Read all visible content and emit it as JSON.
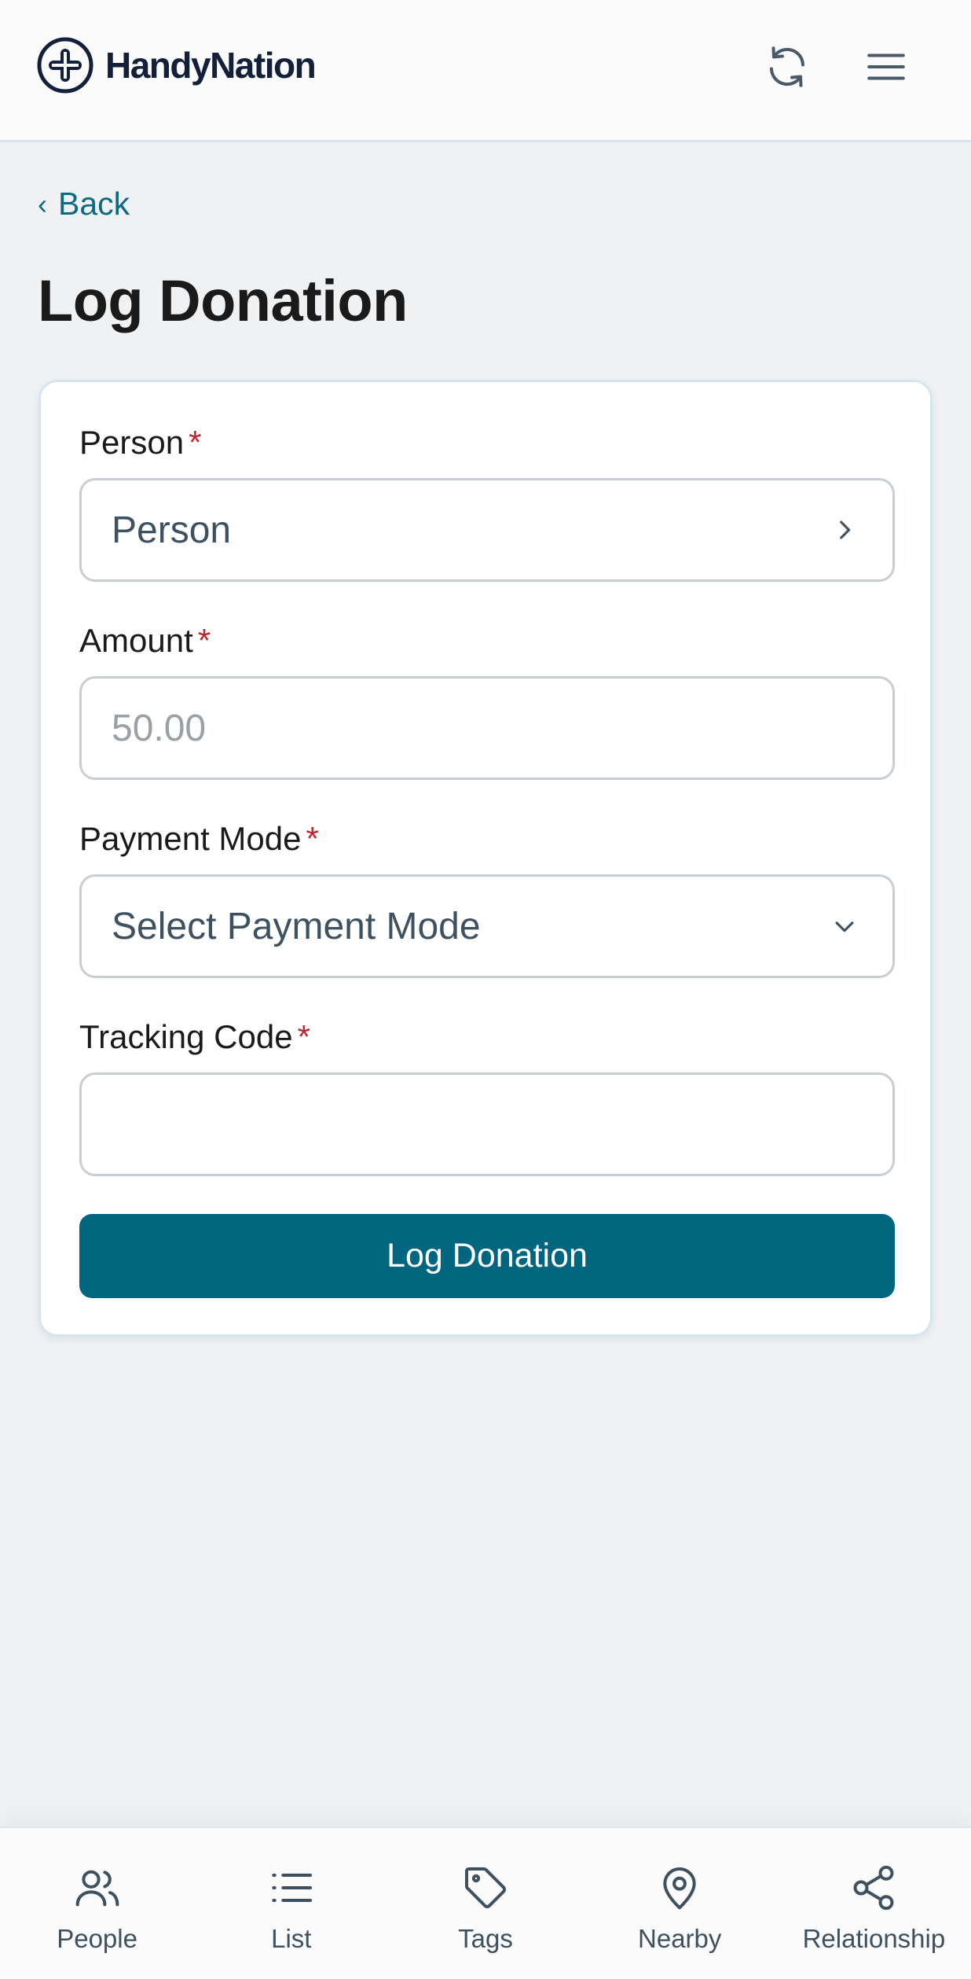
{
  "header": {
    "app_name": "HandyNation",
    "logo_icon": "handynation-logo-icon",
    "refresh_icon": "refresh-icon",
    "menu_icon": "hamburger-menu-icon"
  },
  "nav": {
    "back_label": "Back",
    "back_icon": "chevron-left-icon"
  },
  "page": {
    "title": "Log Donation"
  },
  "form": {
    "person": {
      "label": "Person",
      "required_mark": "*",
      "value": "Person",
      "icon": "chevron-right-icon"
    },
    "amount": {
      "label": "Amount",
      "required_mark": "*",
      "placeholder": "50.00",
      "value": ""
    },
    "payment_mode": {
      "label": "Payment Mode",
      "required_mark": "*",
      "value": "Select Payment Mode",
      "icon": "chevron-down-icon"
    },
    "tracking_code": {
      "label": "Tracking Code",
      "required_mark": "*",
      "value": ""
    },
    "submit_label": "Log Donation"
  },
  "bottom_nav": {
    "items": [
      {
        "label": "People",
        "icon": "people-icon"
      },
      {
        "label": "List",
        "icon": "list-icon"
      },
      {
        "label": "Tags",
        "icon": "tag-icon"
      },
      {
        "label": "Nearby",
        "icon": "map-pin-icon"
      },
      {
        "label": "Relationship",
        "icon": "share-nodes-icon"
      }
    ]
  },
  "colors": {
    "accent": "#006680",
    "link": "#0b6a82",
    "required": "#c0262d",
    "background": "#eff1f3"
  }
}
